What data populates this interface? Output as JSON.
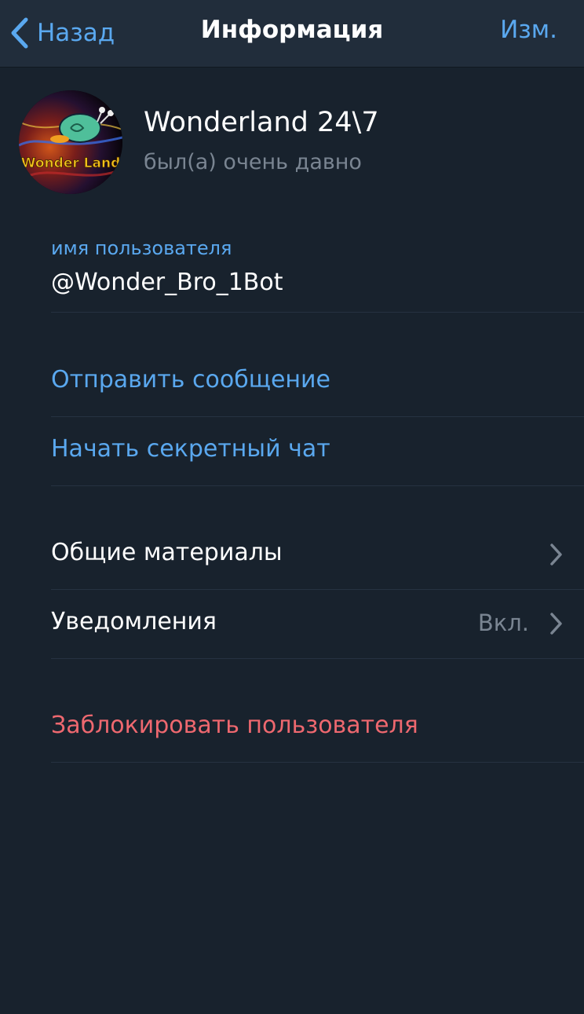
{
  "navbar": {
    "back_label": "Назад",
    "title": "Информация",
    "edit_label": "Изм."
  },
  "profile": {
    "name": "Wonderland 24\\7",
    "status": "был(а) очень давно",
    "avatar_text": "Wonder Land"
  },
  "username": {
    "label": "имя пользователя",
    "value": "@Wonder_Bro_1Bot"
  },
  "actions": {
    "send_message": "Отправить сообщение",
    "secret_chat": "Начать секретный чат"
  },
  "settings": {
    "shared_media": "Общие материалы",
    "notifications": "Уведомления",
    "notifications_value": "Вкл."
  },
  "block": {
    "label": "Заблокировать пользователя"
  },
  "colors": {
    "background": "#18222d",
    "navbar": "#212d3b",
    "accent": "#5aa8ef",
    "destructive": "#ee686f",
    "secondary_text": "#7a8592"
  },
  "icons": {
    "back": "chevron-left-icon",
    "disclosure": "chevron-right-icon"
  }
}
